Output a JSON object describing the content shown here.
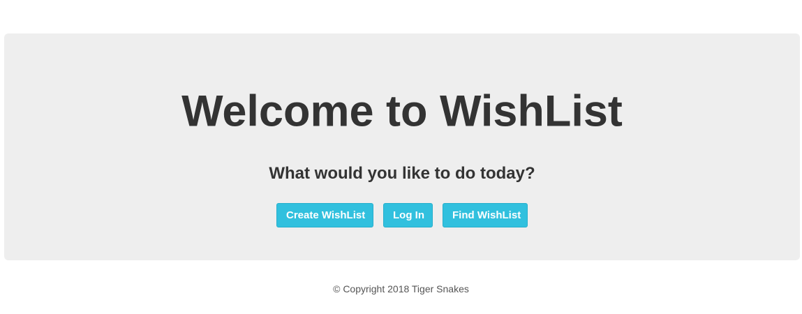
{
  "jumbotron": {
    "title": "Welcome to WishList",
    "subtitle": "What would you like to do today?",
    "buttons": {
      "create_label": "Create WishList",
      "login_label": "Log In",
      "find_label": "Find WishList"
    }
  },
  "footer": {
    "copyright": "© Copyright 2018 Tiger Snakes"
  },
  "colors": {
    "panel_background": "#eeeeee",
    "button_background": "#31c0de",
    "text": "#333333"
  }
}
